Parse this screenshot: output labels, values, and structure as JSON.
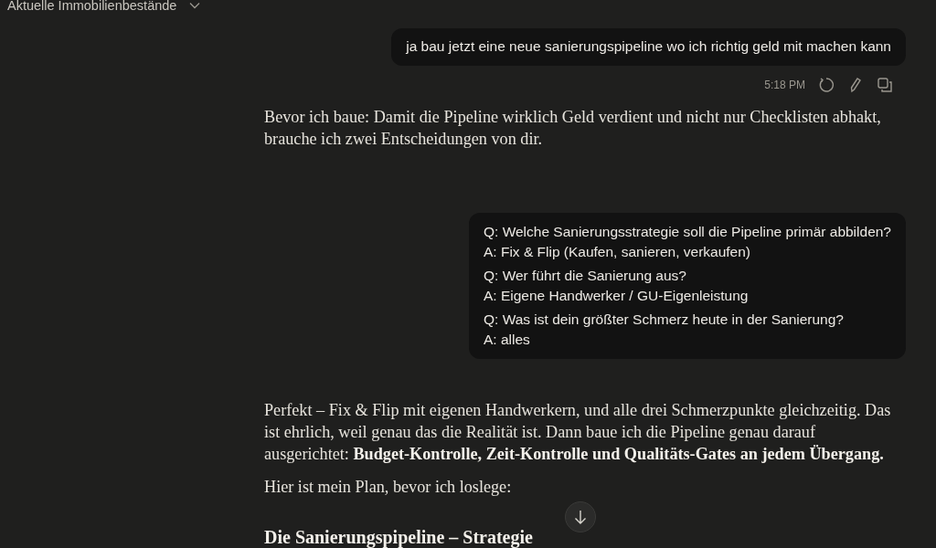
{
  "header": {
    "title": "Aktuelle Immobilienbestände"
  },
  "messages": [
    {
      "kind": "user",
      "text": "ja bau jetzt eine neue sanierungspipeline wo ich richtig geld mit machen kann",
      "time": "5:18 PM"
    },
    {
      "kind": "assistant",
      "paragraphs": [
        "Bevor ich baue: Damit die Pipeline wirklich Geld verdient und nicht nur Checklisten abhakt, brauche ich zwei Entscheidungen von dir."
      ]
    },
    {
      "kind": "answers",
      "items": [
        {
          "q": "Q: Welche Sanierungsstrategie soll die Pipeline primär abbilden?",
          "a": "A: Fix & Flip (Kaufen, sanieren, verkaufen)"
        },
        {
          "q": "Q: Wer führt die Sanierung aus?",
          "a": "A: Eigene Handwerker / GU-Eigenleistung"
        },
        {
          "q": "Q: Was ist dein größter Schmerz heute in der Sanierung?",
          "a": "A: alles"
        }
      ]
    },
    {
      "kind": "assistant",
      "paragraphs": [
        "Perfekt – Fix & Flip mit eigenen Handwerkern, und alle drei Schmerzpunkte gleichzeitig. Das ist ehrlich, weil genau das die Realität ist. Dann baue ich die Pipeline genau darauf ausgerichtet: **Budget-Kontrolle, Zeit-Kontrolle und Qualitäts-Gates an jedem Übergang.**",
        "Hier ist mein Plan, bevor ich loslege:"
      ],
      "heading": "Die Sanierungspipeline – Strategie"
    }
  ]
}
